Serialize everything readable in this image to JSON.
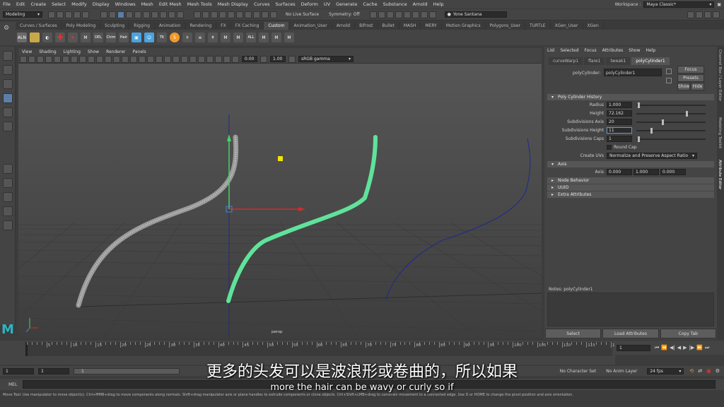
{
  "menubar": {
    "items": [
      "File",
      "Edit",
      "Create",
      "Select",
      "Modify",
      "Display",
      "Windows",
      "Mesh",
      "Edit Mesh",
      "Mesh Tools",
      "Mesh Display",
      "Curves",
      "Surfaces",
      "Deform",
      "UV",
      "Generate",
      "Cache",
      "Substance",
      "Arnold",
      "Help"
    ],
    "workspace_label": "Workspace :",
    "workspace_value": "Maya Classic*"
  },
  "statusline": {
    "mode": "Modeling",
    "live_surface": "No Live Surface",
    "symmetry": "Symmetry: Off",
    "user": "Yone Santana"
  },
  "shelf": {
    "tabs": [
      "Curves / Surfaces",
      "Poly Modeling",
      "Sculpting",
      "Rigging",
      "Animation",
      "Rendering",
      "FX",
      "FX Caching",
      "Custom",
      "Animation_User",
      "Arnold",
      "Bifrost",
      "Bullet",
      "MASH",
      "MERY",
      "Motion Graphics",
      "Polygons_User",
      "TURTLE",
      "XGen_User",
      "XGen"
    ],
    "active_tab": "Custom",
    "icon_labels": [
      "ALN",
      "DEL",
      "Chim",
      "Hair",
      "TK",
      "ALL"
    ]
  },
  "viewport": {
    "menu": [
      "View",
      "Shading",
      "Lighting",
      "Show",
      "Renderer",
      "Panels"
    ],
    "exposure": "0.00",
    "gamma": "1.00",
    "color_space": "sRGB gamma",
    "camera_label": "persp"
  },
  "attribute_editor": {
    "menu": [
      "List",
      "Selected",
      "Focus",
      "Attributes",
      "Show",
      "Help"
    ],
    "tabs": [
      "curveWarp1",
      "flare1",
      "tweak1",
      "polyCylinder1"
    ],
    "active_tab": "polyCylinder1",
    "node_label": "polyCylinder:",
    "node_name": "polyCylinder1",
    "focus_btn": "Focus",
    "presets_btn": "Presets",
    "show_btn": "Show",
    "hide_btn": "Hide",
    "history_section": "Poly Cylinder History",
    "radius_label": "Radius",
    "radius": "1.000",
    "height_label": "Height",
    "height": "72.162",
    "subdiv_axis_label": "Subdivisions Axis",
    "subdiv_axis": "20",
    "subdiv_height_label": "Subdivisions Height",
    "subdiv_height": "11",
    "subdiv_caps_label": "Subdivisions Caps",
    "subdiv_caps": "1",
    "round_cap_label": "Round Cap",
    "create_uvs_label": "Create UVs",
    "create_uvs": "Normalize and Preserve Aspect Ratio",
    "axis_section": "Axis",
    "axis_label": "Axis",
    "axis_x": "0.000",
    "axis_y": "1.000",
    "axis_z": "0.000",
    "node_behavior": "Node Behavior",
    "uuid": "UUID",
    "extra_attributes": "Extra Attributes",
    "notes_label": "Notes:  polyCylinder1",
    "select_btn": "Select",
    "load_btn": "Load Attributes",
    "copy_btn": "Copy Tab"
  },
  "side_tabs": [
    "Channel Box / Layer Editor",
    "Modeling Toolkit",
    "Attribute Editor"
  ],
  "timeslider": {
    "ticks": [
      "5",
      "10",
      "15",
      "20",
      "25",
      "30",
      "35",
      "40",
      "45",
      "50",
      "55",
      "60",
      "65",
      "70",
      "75",
      "80",
      "85",
      "90",
      "95",
      "100",
      "105",
      "110",
      "115",
      "120"
    ],
    "current_frame": "1",
    "range_start": "1",
    "range_inner_start": "1",
    "character_set": "No Character Set",
    "anim_layer": "No Anim Layer",
    "fps": "24 fps"
  },
  "cmdline": {
    "label": "MEL"
  },
  "helpline": "Move Tool: Use manipulator to move object(s). Ctrl+MMB+drag to move components along normals. Shift+drag manipulator axis or plane handles to extrude components or clone objects. Ctrl+Shift+LMB+drag to constrain movement to a connected edge. Use D or HOME to change the pivot position and axis orientation.",
  "subtitle": {
    "zh": "更多的头发可以是波浪形或卷曲的，所以如果",
    "en": "more the hair can be wavy or curly so if"
  },
  "colors": {
    "accent": "#5b7fa8",
    "green_curve": "#5fe39a",
    "maya_logo": "#29b6c6"
  }
}
